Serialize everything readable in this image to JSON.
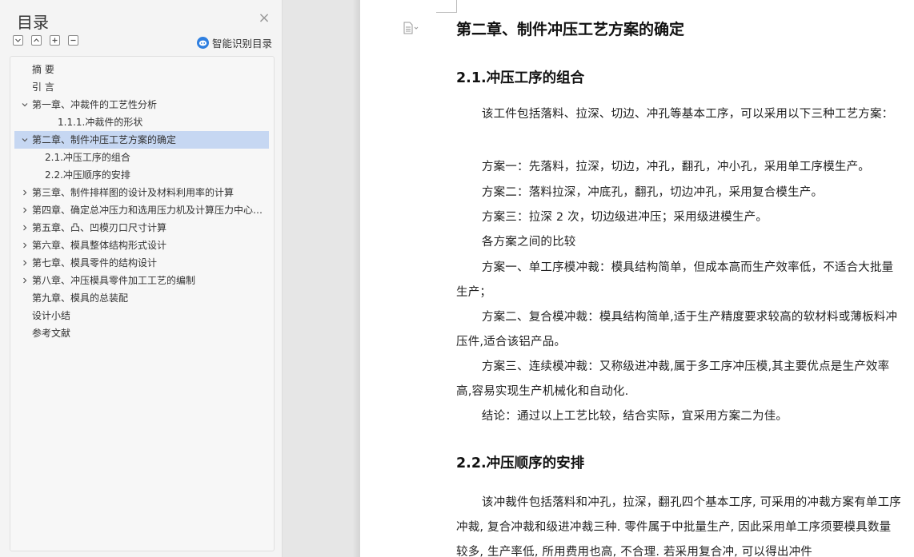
{
  "nav": {
    "title": "目录",
    "close_glyph": "×",
    "smart_toc_label": "智能识别目录",
    "tools": [
      "collapse-all-icon",
      "expand-all-icon",
      "add-heading-icon",
      "remove-heading-icon"
    ],
    "items": [
      {
        "label": "摘    要",
        "level": 1,
        "arrow": "none",
        "selected": false
      },
      {
        "label": "引    言",
        "level": 1,
        "arrow": "none",
        "selected": false
      },
      {
        "label": "第一章、冲裁件的工艺性分析",
        "level": 1,
        "arrow": "down",
        "selected": false
      },
      {
        "label": "1.1.1.冲裁件的形状",
        "level": 3,
        "arrow": "none",
        "selected": false
      },
      {
        "label": "第二章、制件冲压工艺方案的确定",
        "level": 1,
        "arrow": "down",
        "selected": true
      },
      {
        "label": "2.1.冲压工序的组合",
        "level": 2,
        "arrow": "none",
        "selected": false
      },
      {
        "label": "2.2.冲压顺序的安排",
        "level": 2,
        "arrow": "none",
        "selected": false
      },
      {
        "label": "第三章、制件排样图的设计及材料利用率的计算",
        "level": 1,
        "arrow": "right",
        "selected": false
      },
      {
        "label": "第四章、确定总冲压力和选用压力机及计算压力中心 ...",
        "level": 1,
        "arrow": "right",
        "selected": false
      },
      {
        "label": "第五章、凸、凹模刃口尺寸计算",
        "level": 1,
        "arrow": "right",
        "selected": false
      },
      {
        "label": "第六章、模具整体结构形式设计",
        "level": 1,
        "arrow": "right",
        "selected": false
      },
      {
        "label": "第七章、模具零件的结构设计",
        "level": 1,
        "arrow": "right",
        "selected": false
      },
      {
        "label": "第八章、冲压模具零件加工工艺的编制",
        "level": 1,
        "arrow": "right",
        "selected": false
      },
      {
        "label": "第九章、模具的总装配",
        "level": 1,
        "arrow": "none",
        "selected": false
      },
      {
        "label": "设计小结",
        "level": 1,
        "arrow": "none",
        "selected": false
      },
      {
        "label": "参考文献",
        "level": 1,
        "arrow": "none",
        "selected": false
      }
    ]
  },
  "doc": {
    "chapter_title": "第二章、制件冲压工艺方案的确定",
    "section1_title": "2.1.冲压工序的组合",
    "section1_paras": [
      " 该工件包括落料、拉深、切边、冲孔等基本工序，可以采用以下三种工艺方案：",
      "方案一：先落料，拉深，切边，冲孔，翻孔，冲小孔，采用单工序模生产。",
      "方案二：落料拉深，冲底孔，翻孔，切边冲孔，采用复合模生产。",
      "方案三：拉深 2 次，切边级进冲压；采用级进模生产。",
      "各方案之间的比较",
      "方案一、单工序模冲裁：模具结构简单，但成本高而生产效率低，不适合大批量生产；",
      "方案二、复合模冲裁：模具结构简单,适于生产精度要求较高的软材料或薄板料冲压件,适合该铝产品。",
      "方案三、连续模冲裁：又称级进冲裁,属于多工序冲压模,其主要优点是生产效率高,容易实现生产机械化和自动化.",
      " 结论：通过以上工艺比较，结合实际，宜采用方案二为佳。"
    ],
    "section2_title": "2.2.冲压顺序的安排",
    "section2_paras": [
      "该冲裁件包括落料和冲孔，拉深，翻孔四个基本工序, 可采用的冲裁方案有单工序冲裁, 复合冲裁和级进冲裁三种. 零件属于中批量生产, 因此采用单工序须要模具数量较多, 生产率低, 所用费用也高, 不合理. 若采用复合冲, 可以得出冲件"
    ],
    "doc_icon": "document-icon"
  }
}
